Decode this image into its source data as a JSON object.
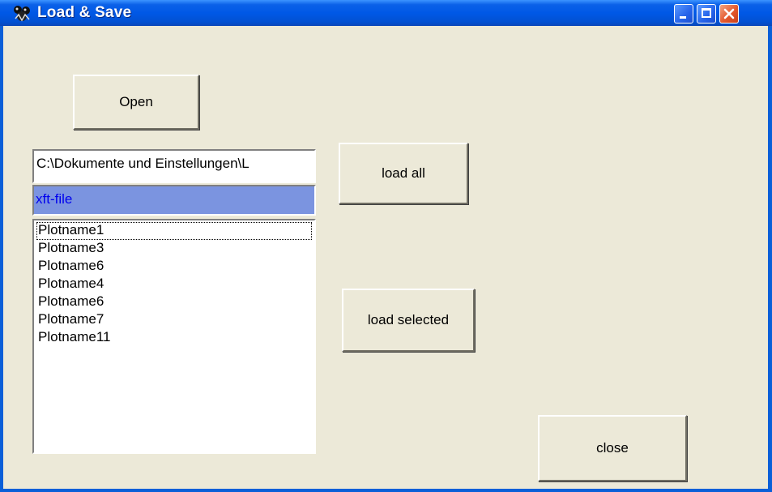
{
  "window": {
    "title": "Load & Save",
    "icon": "app-icon"
  },
  "titlebar": {
    "minimize": "minimize-icon",
    "maximize": "maximize-icon",
    "close": "close-icon"
  },
  "buttons": {
    "open": "Open",
    "load_all": "load all",
    "load_selected": "load selected",
    "close": "close"
  },
  "path_field": {
    "value": "C:\\Dokumente und Einstellungen\\L"
  },
  "file_type": {
    "value": "xft-file"
  },
  "plot_list": {
    "items": [
      "Plotname1",
      "Plotname3",
      "Plotname6",
      "Plotname4",
      "Plotname6",
      "Plotname7",
      "Plotname11"
    ],
    "focused_index": 0
  },
  "colors": {
    "titlebar": "#0058e6",
    "window_bg": "#ece9d8",
    "filter_bg": "#7b94e0",
    "filter_text": "#0000ee"
  }
}
